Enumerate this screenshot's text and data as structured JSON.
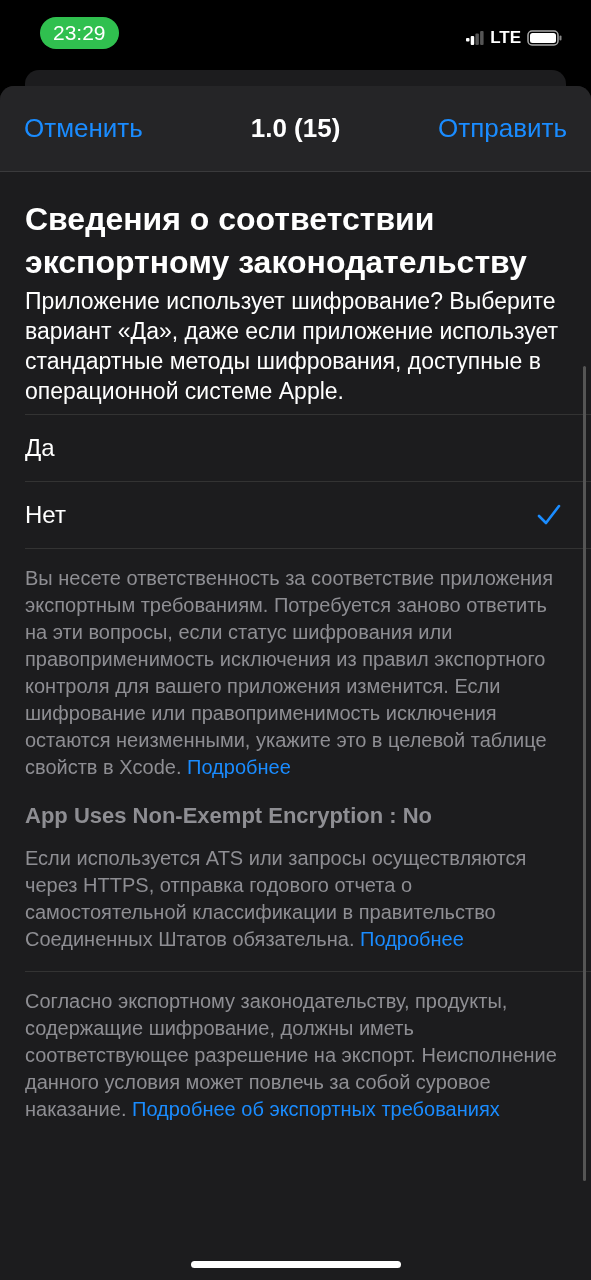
{
  "status_bar": {
    "time": "23:29",
    "network": "LTE"
  },
  "nav": {
    "cancel": "Отменить",
    "title": "1.0 (15)",
    "send": "Отправить"
  },
  "section": {
    "title": "Сведения о соответствии экспортному законодательству",
    "description": "Приложение использует шифрование? Выберите вариант «Да», даже если приложение использует стандартные методы шифрования, доступные в операционной системе Apple."
  },
  "options": [
    {
      "label": "Да",
      "selected": false
    },
    {
      "label": "Нет",
      "selected": true
    }
  ],
  "footer": [
    {
      "kind": "paragraph",
      "text": "Вы несете ответственность за соответствие приложения экспортным требованиям. Потребуется заново ответить на эти вопросы, если статус шифрования или правоприменимость исключения из правил экспортного контроля для вашего приложения изменится. Если шифрование или правоприменимость исключения остаются неизменными, укажите это в целевой таблице свойств в Xcode.",
      "link": "Подробнее"
    },
    {
      "kind": "heading",
      "text": "App Uses Non-Exempt Encryption : No"
    },
    {
      "kind": "paragraph",
      "text": "Если используется ATS или запросы осуществляются через HTTPS, отправка годового отчета о самостоятельной классификации в правительство Соединенных Штатов обязательна.",
      "link": "Подробнее"
    }
  ],
  "legal": {
    "text": "Согласно экспортному законодательству, продукты, содержащие шифрование, должны иметь соответствующее разрешение на экспорт. Неисполнение данного условия может повлечь за собой суровое наказание.",
    "link": "Подробнее об экспортных требованиях"
  }
}
